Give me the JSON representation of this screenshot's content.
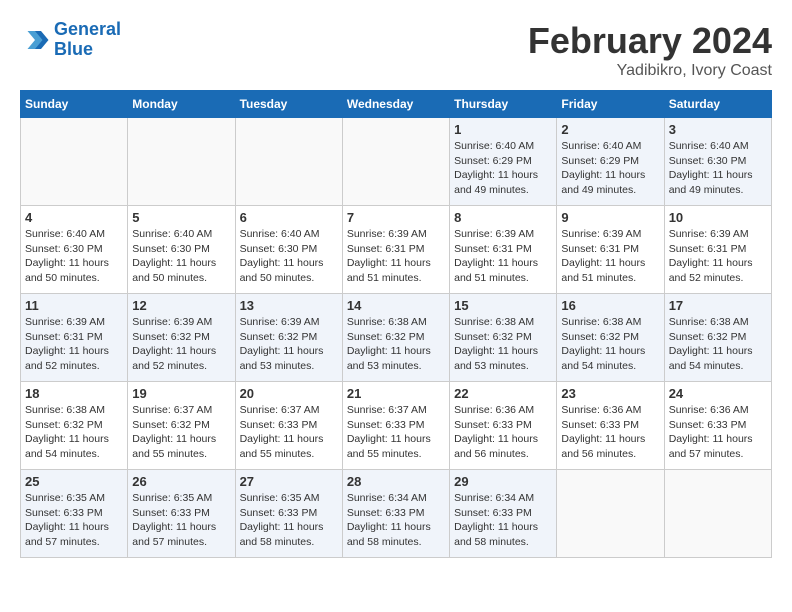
{
  "logo": {
    "line1": "General",
    "line2": "Blue"
  },
  "title": "February 2024",
  "subtitle": "Yadibikro, Ivory Coast",
  "headers": [
    "Sunday",
    "Monday",
    "Tuesday",
    "Wednesday",
    "Thursday",
    "Friday",
    "Saturday"
  ],
  "weeks": [
    [
      {
        "num": "",
        "info": ""
      },
      {
        "num": "",
        "info": ""
      },
      {
        "num": "",
        "info": ""
      },
      {
        "num": "",
        "info": ""
      },
      {
        "num": "1",
        "info": "Sunrise: 6:40 AM\nSunset: 6:29 PM\nDaylight: 11 hours\nand 49 minutes."
      },
      {
        "num": "2",
        "info": "Sunrise: 6:40 AM\nSunset: 6:29 PM\nDaylight: 11 hours\nand 49 minutes."
      },
      {
        "num": "3",
        "info": "Sunrise: 6:40 AM\nSunset: 6:30 PM\nDaylight: 11 hours\nand 49 minutes."
      }
    ],
    [
      {
        "num": "4",
        "info": "Sunrise: 6:40 AM\nSunset: 6:30 PM\nDaylight: 11 hours\nand 50 minutes."
      },
      {
        "num": "5",
        "info": "Sunrise: 6:40 AM\nSunset: 6:30 PM\nDaylight: 11 hours\nand 50 minutes."
      },
      {
        "num": "6",
        "info": "Sunrise: 6:40 AM\nSunset: 6:30 PM\nDaylight: 11 hours\nand 50 minutes."
      },
      {
        "num": "7",
        "info": "Sunrise: 6:39 AM\nSunset: 6:31 PM\nDaylight: 11 hours\nand 51 minutes."
      },
      {
        "num": "8",
        "info": "Sunrise: 6:39 AM\nSunset: 6:31 PM\nDaylight: 11 hours\nand 51 minutes."
      },
      {
        "num": "9",
        "info": "Sunrise: 6:39 AM\nSunset: 6:31 PM\nDaylight: 11 hours\nand 51 minutes."
      },
      {
        "num": "10",
        "info": "Sunrise: 6:39 AM\nSunset: 6:31 PM\nDaylight: 11 hours\nand 52 minutes."
      }
    ],
    [
      {
        "num": "11",
        "info": "Sunrise: 6:39 AM\nSunset: 6:31 PM\nDaylight: 11 hours\nand 52 minutes."
      },
      {
        "num": "12",
        "info": "Sunrise: 6:39 AM\nSunset: 6:32 PM\nDaylight: 11 hours\nand 52 minutes."
      },
      {
        "num": "13",
        "info": "Sunrise: 6:39 AM\nSunset: 6:32 PM\nDaylight: 11 hours\nand 53 minutes."
      },
      {
        "num": "14",
        "info": "Sunrise: 6:38 AM\nSunset: 6:32 PM\nDaylight: 11 hours\nand 53 minutes."
      },
      {
        "num": "15",
        "info": "Sunrise: 6:38 AM\nSunset: 6:32 PM\nDaylight: 11 hours\nand 53 minutes."
      },
      {
        "num": "16",
        "info": "Sunrise: 6:38 AM\nSunset: 6:32 PM\nDaylight: 11 hours\nand 54 minutes."
      },
      {
        "num": "17",
        "info": "Sunrise: 6:38 AM\nSunset: 6:32 PM\nDaylight: 11 hours\nand 54 minutes."
      }
    ],
    [
      {
        "num": "18",
        "info": "Sunrise: 6:38 AM\nSunset: 6:32 PM\nDaylight: 11 hours\nand 54 minutes."
      },
      {
        "num": "19",
        "info": "Sunrise: 6:37 AM\nSunset: 6:32 PM\nDaylight: 11 hours\nand 55 minutes."
      },
      {
        "num": "20",
        "info": "Sunrise: 6:37 AM\nSunset: 6:33 PM\nDaylight: 11 hours\nand 55 minutes."
      },
      {
        "num": "21",
        "info": "Sunrise: 6:37 AM\nSunset: 6:33 PM\nDaylight: 11 hours\nand 55 minutes."
      },
      {
        "num": "22",
        "info": "Sunrise: 6:36 AM\nSunset: 6:33 PM\nDaylight: 11 hours\nand 56 minutes."
      },
      {
        "num": "23",
        "info": "Sunrise: 6:36 AM\nSunset: 6:33 PM\nDaylight: 11 hours\nand 56 minutes."
      },
      {
        "num": "24",
        "info": "Sunrise: 6:36 AM\nSunset: 6:33 PM\nDaylight: 11 hours\nand 57 minutes."
      }
    ],
    [
      {
        "num": "25",
        "info": "Sunrise: 6:35 AM\nSunset: 6:33 PM\nDaylight: 11 hours\nand 57 minutes."
      },
      {
        "num": "26",
        "info": "Sunrise: 6:35 AM\nSunset: 6:33 PM\nDaylight: 11 hours\nand 57 minutes."
      },
      {
        "num": "27",
        "info": "Sunrise: 6:35 AM\nSunset: 6:33 PM\nDaylight: 11 hours\nand 58 minutes."
      },
      {
        "num": "28",
        "info": "Sunrise: 6:34 AM\nSunset: 6:33 PM\nDaylight: 11 hours\nand 58 minutes."
      },
      {
        "num": "29",
        "info": "Sunrise: 6:34 AM\nSunset: 6:33 PM\nDaylight: 11 hours\nand 58 minutes."
      },
      {
        "num": "",
        "info": ""
      },
      {
        "num": "",
        "info": ""
      }
    ]
  ]
}
